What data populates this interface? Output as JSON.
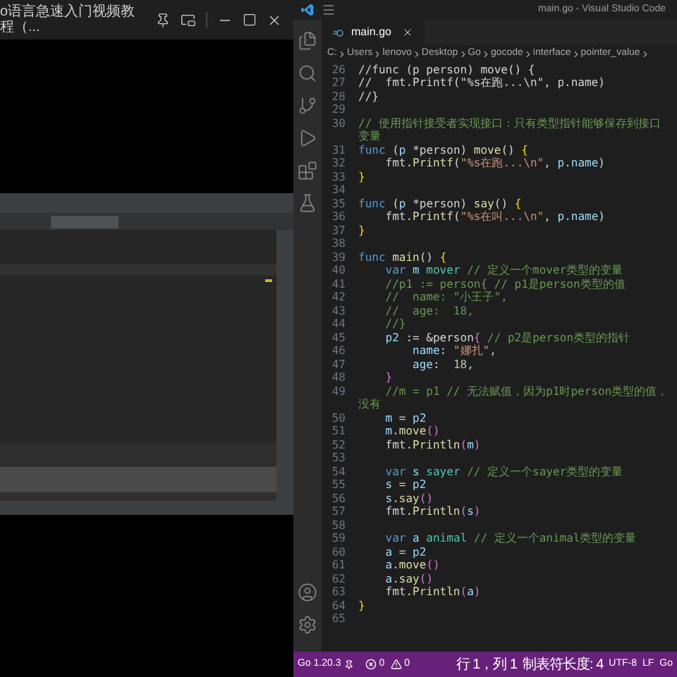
{
  "player": {
    "title": "o语言急速入门视频教程（..."
  },
  "editor_window": {
    "title": "main.go - Visual Studio Code",
    "tabs": [
      {
        "label": "main.go",
        "selected": true
      }
    ],
    "breadcrumb": [
      "C:",
      "Users",
      "lenovo",
      "Desktop",
      "Go",
      "gocode",
      "interface",
      "pointer_value"
    ],
    "lines": [
      {
        "number": "26",
        "tokens": [
          {
            "kind": "plain",
            "text": "//func (p person) move() {"
          }
        ]
      },
      {
        "number": "27",
        "tokens": [
          {
            "kind": "plain",
            "text": "//  fmt.Printf(\"%s在跑...\\n\", p.name)"
          }
        ]
      },
      {
        "number": "28",
        "tokens": [
          {
            "kind": "plain",
            "text": "//}"
          }
        ]
      },
      {
        "number": "29"
      },
      {
        "number": "30",
        "tokens": [
          {
            "kind": "comment",
            "text": "// 使用指针接受者实现接口：只有类型指针能够保存到接口变量"
          }
        ]
      },
      {
        "number": "31",
        "tokens": [
          {
            "kind": "keyword",
            "text": "func "
          },
          {
            "kind": "plain",
            "text": "("
          },
          {
            "kind": "variable",
            "text": "p "
          },
          {
            "kind": "plain",
            "text": "*person) "
          },
          {
            "kind": "function",
            "text": "move"
          },
          {
            "kind": "plain",
            "text": "() "
          },
          {
            "kind": "bracket",
            "text": "{"
          }
        ]
      },
      {
        "number": "32",
        "tokens": [
          {
            "kind": "plain",
            "text": "    fmt."
          },
          {
            "kind": "function",
            "text": "Printf"
          },
          {
            "kind": "plain",
            "text": "("
          },
          {
            "kind": "string",
            "text": "\"%s在跑...\\n\""
          },
          {
            "kind": "plain",
            "text": ", "
          },
          {
            "kind": "variable",
            "text": "p.name"
          },
          {
            "kind": "plain",
            "text": ")"
          }
        ]
      },
      {
        "number": "33",
        "tokens": [
          {
            "kind": "bracket",
            "text": "}"
          }
        ]
      },
      {
        "number": "34"
      },
      {
        "number": "35",
        "tokens": [
          {
            "kind": "keyword",
            "text": "func "
          },
          {
            "kind": "plain",
            "text": "("
          },
          {
            "kind": "variable",
            "text": "p "
          },
          {
            "kind": "plain",
            "text": "*person) "
          },
          {
            "kind": "function",
            "text": "say"
          },
          {
            "kind": "plain",
            "text": "() "
          },
          {
            "kind": "bracket",
            "text": "{"
          }
        ]
      },
      {
        "number": "36",
        "tokens": [
          {
            "kind": "plain",
            "text": "    fmt."
          },
          {
            "kind": "function",
            "text": "Printf"
          },
          {
            "kind": "plain",
            "text": "("
          },
          {
            "kind": "string",
            "text": "\"%s在叫...\\n\""
          },
          {
            "kind": "plain",
            "text": ", "
          },
          {
            "kind": "variable",
            "text": "p.name"
          },
          {
            "kind": "plain",
            "text": ")"
          }
        ]
      },
      {
        "number": "37",
        "tokens": [
          {
            "kind": "bracket",
            "text": "}"
          }
        ]
      },
      {
        "number": "38"
      },
      {
        "number": "39",
        "tokens": [
          {
            "kind": "keyword",
            "text": "func "
          },
          {
            "kind": "function",
            "text": "main"
          },
          {
            "kind": "plain",
            "text": "() "
          },
          {
            "kind": "bracket",
            "text": "{"
          }
        ]
      },
      {
        "number": "40",
        "tokens": [
          {
            "kind": "keyword",
            "text": "    var "
          },
          {
            "kind": "variable",
            "text": "m "
          },
          {
            "kind": "type",
            "text": "mover "
          },
          {
            "kind": "comment",
            "text": "// 定义一个mover类型的变量"
          }
        ]
      },
      {
        "number": "41",
        "tokens": [
          {
            "kind": "comment",
            "text": "    //p1 := person{ // p1是person类型的值"
          }
        ]
      },
      {
        "number": "42",
        "tokens": [
          {
            "kind": "comment",
            "text": "    //  name: \"小王子\","
          }
        ]
      },
      {
        "number": "43",
        "tokens": [
          {
            "kind": "comment",
            "text": "    //  age:  18,"
          }
        ]
      },
      {
        "number": "44",
        "tokens": [
          {
            "kind": "comment",
            "text": "    //}"
          }
        ]
      },
      {
        "number": "45",
        "tokens": [
          {
            "kind": "variable",
            "text": "    p2 "
          },
          {
            "kind": "plain",
            "text": ":= &person"
          },
          {
            "kind": "bracket2",
            "text": "{ "
          },
          {
            "kind": "comment",
            "text": "// p2是person类型的指针"
          }
        ]
      },
      {
        "number": "46",
        "tokens": [
          {
            "kind": "variable",
            "text": "        name"
          },
          {
            "kind": "plain",
            "text": ": "
          },
          {
            "kind": "string",
            "text": "\"娜扎\""
          },
          {
            "kind": "plain",
            "text": ","
          }
        ]
      },
      {
        "number": "47",
        "tokens": [
          {
            "kind": "variable",
            "text": "        age"
          },
          {
            "kind": "plain",
            "text": ":  "
          },
          {
            "kind": "number",
            "text": "18"
          },
          {
            "kind": "plain",
            "text": ","
          }
        ]
      },
      {
        "number": "48",
        "tokens": [
          {
            "kind": "bracket2",
            "text": "    }"
          }
        ]
      },
      {
        "number": "49",
        "tokens": [
          {
            "kind": "comment",
            "text": "    //m = p1 // 无法赋值，因为p1时person类型的值，没有"
          }
        ]
      },
      {
        "number": "50",
        "tokens": [
          {
            "kind": "variable",
            "text": "    m "
          },
          {
            "kind": "plain",
            "text": "= "
          },
          {
            "kind": "variable",
            "text": "p2"
          }
        ]
      },
      {
        "number": "51",
        "tokens": [
          {
            "kind": "variable",
            "text": "    m"
          },
          {
            "kind": "plain",
            "text": "."
          },
          {
            "kind": "function",
            "text": "move"
          },
          {
            "kind": "bracket2",
            "text": "()"
          }
        ]
      },
      {
        "number": "52",
        "tokens": [
          {
            "kind": "plain",
            "text": "    fmt."
          },
          {
            "kind": "function",
            "text": "Println"
          },
          {
            "kind": "bracket2",
            "text": "("
          },
          {
            "kind": "variable",
            "text": "m"
          },
          {
            "kind": "bracket2",
            "text": ")"
          }
        ]
      },
      {
        "number": "53"
      },
      {
        "number": "54",
        "tokens": [
          {
            "kind": "keyword",
            "text": "    var "
          },
          {
            "kind": "variable",
            "text": "s "
          },
          {
            "kind": "type",
            "text": "sayer "
          },
          {
            "kind": "comment",
            "text": "// 定义一个sayer类型的变量"
          }
        ]
      },
      {
        "number": "55",
        "tokens": [
          {
            "kind": "variable",
            "text": "    s "
          },
          {
            "kind": "plain",
            "text": "= "
          },
          {
            "kind": "variable",
            "text": "p2"
          }
        ]
      },
      {
        "number": "56",
        "tokens": [
          {
            "kind": "variable",
            "text": "    s"
          },
          {
            "kind": "plain",
            "text": "."
          },
          {
            "kind": "function",
            "text": "say"
          },
          {
            "kind": "bracket2",
            "text": "()"
          }
        ]
      },
      {
        "number": "57",
        "tokens": [
          {
            "kind": "plain",
            "text": "    fmt."
          },
          {
            "kind": "function",
            "text": "Println"
          },
          {
            "kind": "bracket2",
            "text": "("
          },
          {
            "kind": "variable",
            "text": "s"
          },
          {
            "kind": "bracket2",
            "text": ")"
          }
        ]
      },
      {
        "number": "58"
      },
      {
        "number": "59",
        "tokens": [
          {
            "kind": "keyword",
            "text": "    var "
          },
          {
            "kind": "variable",
            "text": "a "
          },
          {
            "kind": "type",
            "text": "animal "
          },
          {
            "kind": "comment",
            "text": "// 定义一个animal类型的变量"
          }
        ]
      },
      {
        "number": "60",
        "tokens": [
          {
            "kind": "variable",
            "text": "    a "
          },
          {
            "kind": "plain",
            "text": "= "
          },
          {
            "kind": "variable",
            "text": "p2"
          }
        ]
      },
      {
        "number": "61",
        "tokens": [
          {
            "kind": "variable",
            "text": "    a"
          },
          {
            "kind": "plain",
            "text": "."
          },
          {
            "kind": "function",
            "text": "move"
          },
          {
            "kind": "bracket2",
            "text": "()"
          }
        ]
      },
      {
        "number": "62",
        "tokens": [
          {
            "kind": "variable",
            "text": "    a"
          },
          {
            "kind": "plain",
            "text": "."
          },
          {
            "kind": "function",
            "text": "say"
          },
          {
            "kind": "bracket2",
            "text": "()"
          }
        ]
      },
      {
        "number": "63",
        "tokens": [
          {
            "kind": "plain",
            "text": "    fmt."
          },
          {
            "kind": "function",
            "text": "Println"
          },
          {
            "kind": "bracket2",
            "text": "("
          },
          {
            "kind": "variable",
            "text": "a"
          },
          {
            "kind": "bracket2",
            "text": ")"
          }
        ]
      },
      {
        "number": "64",
        "tokens": [
          {
            "kind": "bracket",
            "text": "}"
          }
        ]
      },
      {
        "number": "65"
      }
    ]
  },
  "status_bar": [
    {
      "kind": "version",
      "text": "Go 1.20.3"
    },
    {
      "kind": "errors",
      "text": "0"
    },
    {
      "kind": "warnings",
      "text": "0"
    },
    {
      "kind": "position",
      "text": "行 1，列 1"
    },
    {
      "kind": "indent",
      "text": "制表符长度: 4"
    },
    {
      "kind": "encoding",
      "text": "UTF-8"
    },
    {
      "kind": "eol",
      "text": "LF"
    },
    {
      "kind": "language",
      "text": "Go"
    }
  ]
}
